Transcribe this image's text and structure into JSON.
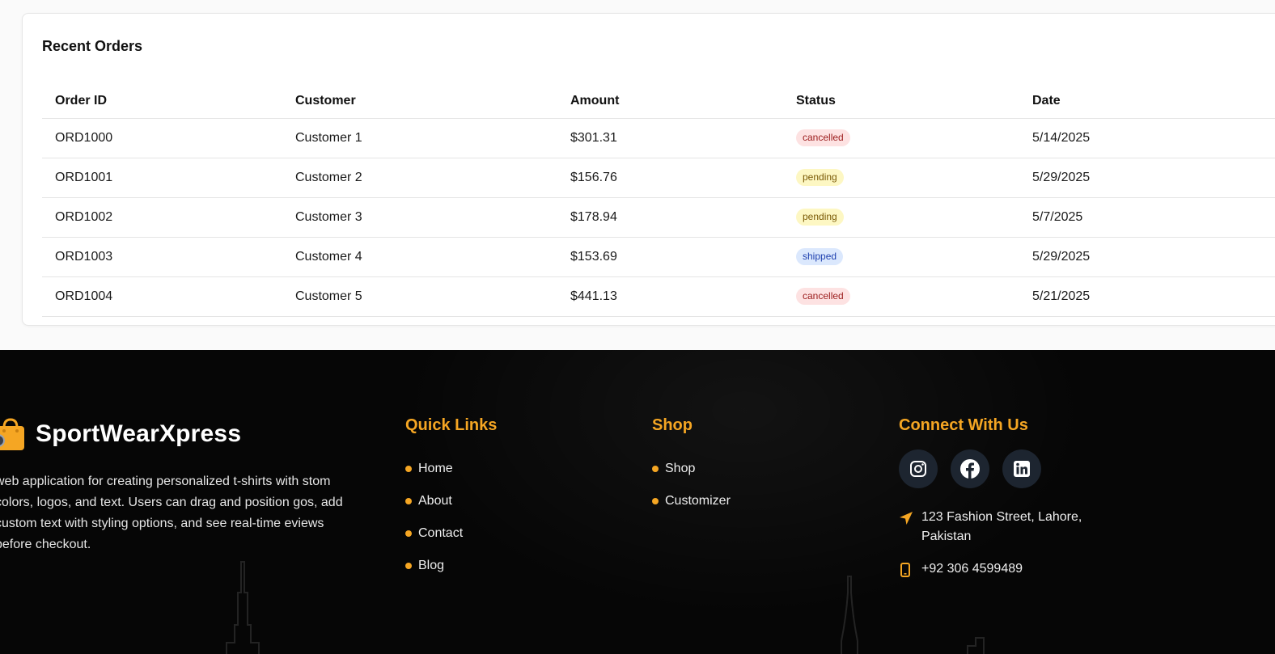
{
  "orders": {
    "title": "Recent Orders",
    "columns": [
      "Order ID",
      "Customer",
      "Amount",
      "Status",
      "Date"
    ],
    "rows": [
      {
        "id": "ORD1000",
        "customer": "Customer 1",
        "amount": "$301.31",
        "status": "cancelled",
        "date": "5/14/2025"
      },
      {
        "id": "ORD1001",
        "customer": "Customer 2",
        "amount": "$156.76",
        "status": "pending",
        "date": "5/29/2025"
      },
      {
        "id": "ORD1002",
        "customer": "Customer 3",
        "amount": "$178.94",
        "status": "pending",
        "date": "5/7/2025"
      },
      {
        "id": "ORD1003",
        "customer": "Customer 4",
        "amount": "$153.69",
        "status": "shipped",
        "date": "5/29/2025"
      },
      {
        "id": "ORD1004",
        "customer": "Customer 5",
        "amount": "$441.13",
        "status": "cancelled",
        "date": "5/21/2025"
      }
    ]
  },
  "footer": {
    "brand": "SportWearXpress",
    "brand_icon": "shopping-bag-icon",
    "description": "web application for creating personalized t-shirts with stom colors, logos, and text. Users can drag and position gos, add custom text with styling options, and see real-time eviews before checkout.",
    "quick_links": {
      "title": "Quick Links",
      "items": [
        "Home",
        "About",
        "Contact",
        "Blog"
      ]
    },
    "shop": {
      "title": "Shop",
      "items": [
        "Shop",
        "Customizer"
      ]
    },
    "connect": {
      "title": "Connect With Us",
      "socials": [
        "instagram-icon",
        "facebook-icon",
        "linkedin-icon"
      ],
      "address_line1": "123 Fashion Street, Lahore,",
      "address_line2": "Pakistan",
      "phone": "+92 306 4599489"
    }
  },
  "colors": {
    "accent": "#f5a623",
    "footer_bg": "#060606",
    "social_bg": "#1d2530",
    "cancelled_bg": "#fde2e2",
    "pending_bg": "#fdf7c3",
    "shipped_bg": "#dbe8fd"
  }
}
